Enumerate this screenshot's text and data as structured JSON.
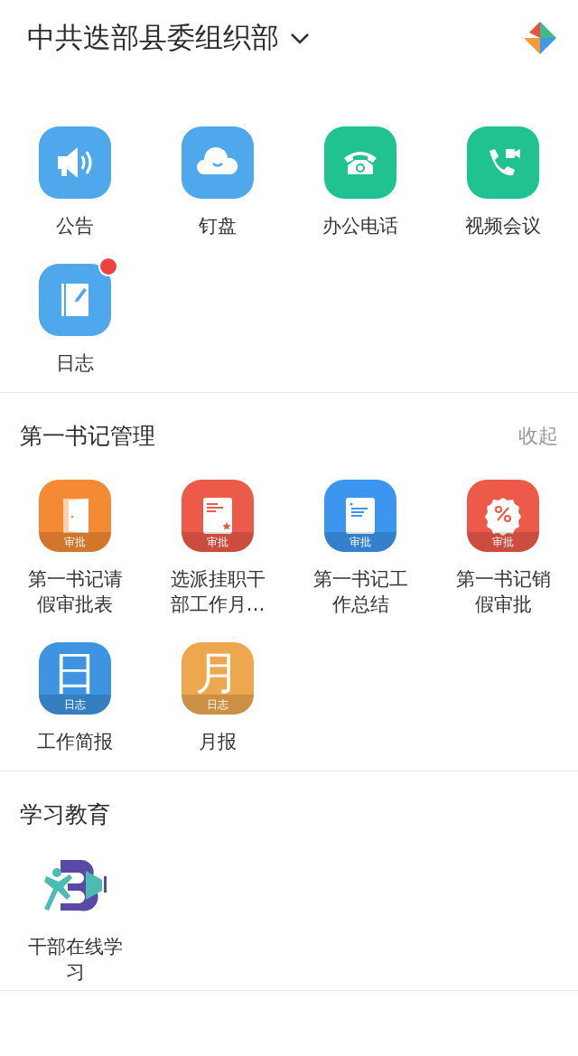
{
  "header": {
    "title": "中共迭部县委组织部"
  },
  "sections": [
    {
      "apps": [
        {
          "label": "公告",
          "kind": "megaphone",
          "color": "#4fa8ec"
        },
        {
          "label": "钉盘",
          "kind": "cloud",
          "color": "#4fa8ec"
        },
        {
          "label": "办公电话",
          "kind": "phone",
          "color": "#1fc290"
        },
        {
          "label": "视频会议",
          "kind": "video",
          "color": "#1fc290"
        },
        {
          "label": "日志",
          "kind": "notebook",
          "color": "#4fa8ec",
          "dot": true
        }
      ]
    },
    {
      "title": "第一书记管理",
      "action": "收起",
      "apps": [
        {
          "label": "第一书记请假审批表",
          "kind": "door",
          "color": "#f58a35",
          "band": "审批"
        },
        {
          "label": "选派挂职干部工作月…",
          "kind": "doc-star",
          "color": "#ee5a4a",
          "band": "审批"
        },
        {
          "label": "第一书记工作总结",
          "kind": "doc",
          "color": "#3c95ee",
          "band": "审批"
        },
        {
          "label": "第一书记销假审批",
          "kind": "percent",
          "color": "#ee5a4a",
          "band": "审批"
        },
        {
          "label": "工作简报",
          "kind": "glyph",
          "glyph": "日",
          "color": "#3e94e0",
          "band": "日志"
        },
        {
          "label": "月报",
          "kind": "glyph",
          "glyph": "月",
          "color": "#eda84f",
          "band": "日志"
        }
      ]
    },
    {
      "title": "学习教育",
      "apps": [
        {
          "label": "干部在线学习",
          "kind": "logo"
        }
      ]
    }
  ]
}
